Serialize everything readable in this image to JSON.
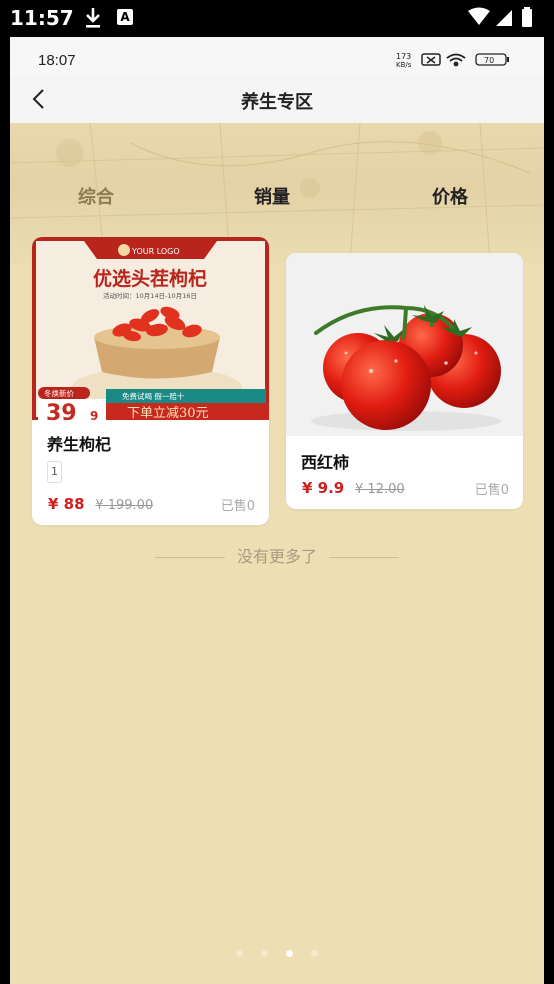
{
  "os_status": {
    "time": "11:57"
  },
  "inner_status": {
    "time": "18:07",
    "net_speed_top": "173",
    "net_speed_bottom": "KB/s",
    "battery": "70"
  },
  "nav": {
    "title": "养生专区"
  },
  "tabs": [
    "综合",
    "销量",
    "价格"
  ],
  "products": [
    {
      "name": "养生枸杞",
      "tag": "1",
      "price": "¥ 88",
      "original_price": "¥ 199.00",
      "sold": "已售0",
      "banner": {
        "logo": "YOUR LOGO",
        "headline": "优选头茬枸杞",
        "date": "活动时间：10月14日-10月16日",
        "badge": "冬焕新价",
        "badge_price": "39",
        "badge_price_tail": "9",
        "ribbon": "免费试喝 假一赔十",
        "promo": "下单立减30元"
      }
    },
    {
      "name": "西红柿",
      "price": "¥ 9.9",
      "original_price": "¥ 12.00",
      "sold": "已售0"
    }
  ],
  "end_text": "没有更多了",
  "colors": {
    "accent": "#d0201e",
    "background": "#eddfb3",
    "active_tab": "#8f7a56"
  }
}
